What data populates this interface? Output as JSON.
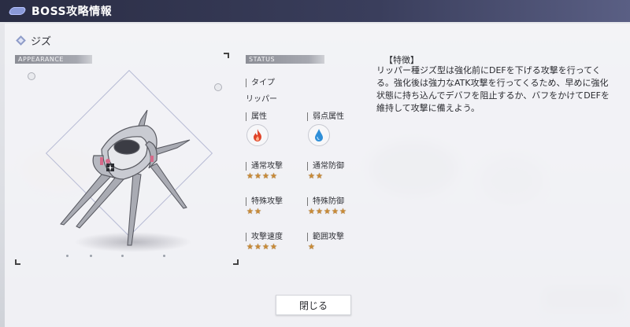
{
  "header": {
    "title": "BOSS攻略情報",
    "icon": "tab-icon",
    "accent": "#8a9ad8"
  },
  "boss": {
    "name": "ジズ"
  },
  "sections": {
    "appearance": "APPEARANCE",
    "status": "STATUS"
  },
  "status": {
    "type_label": "タイプ",
    "type_value": "リッパー",
    "attribute_label": "属性",
    "attribute_icon": "fire-icon",
    "weakness_label": "弱点属性",
    "weakness_icon": "water-icon",
    "stats": [
      {
        "label": "通常攻撃",
        "stars": 4
      },
      {
        "label": "通常防御",
        "stars": 2
      },
      {
        "label": "特殊攻撃",
        "stars": 2
      },
      {
        "label": "特殊防御",
        "stars": 5
      },
      {
        "label": "攻撃速度",
        "stars": 4
      },
      {
        "label": "範囲攻撃",
        "stars": 1
      }
    ]
  },
  "description": {
    "title": "【特徴】",
    "body": "リッパー種ジズ型は強化前にDEFを下げる攻撃を行ってくる。強化後は強力なATK攻撃を行ってくるため、早めに強化状態に持ち込んでデバフを阻止するか、バフをかけてDEFを維持して攻撃に備えよう。"
  },
  "buttons": {
    "close": "閉じる"
  },
  "colors": {
    "star": "#c98a35",
    "fire": "#e0452a",
    "water": "#2f8fd8",
    "header": "#2a2d44"
  }
}
